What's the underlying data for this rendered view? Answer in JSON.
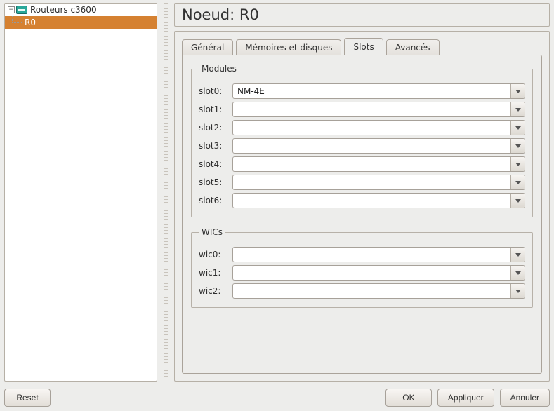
{
  "tree": {
    "root_label": "Routeurs c3600",
    "child_label": "R0"
  },
  "header": {
    "title": "Noeud: R0"
  },
  "tabs": {
    "general": "Général",
    "memdisk": "Mémoires et disques",
    "slots": "Slots",
    "advanced": "Avancés"
  },
  "modules": {
    "legend": "Modules",
    "rows": [
      {
        "label": "slot0:",
        "value": "NM-4E"
      },
      {
        "label": "slot1:",
        "value": ""
      },
      {
        "label": "slot2:",
        "value": ""
      },
      {
        "label": "slot3:",
        "value": ""
      },
      {
        "label": "slot4:",
        "value": ""
      },
      {
        "label": "slot5:",
        "value": ""
      },
      {
        "label": "slot6:",
        "value": ""
      }
    ]
  },
  "wics": {
    "legend": "WICs",
    "rows": [
      {
        "label": "wic0:",
        "value": ""
      },
      {
        "label": "wic1:",
        "value": ""
      },
      {
        "label": "wic2:",
        "value": ""
      }
    ]
  },
  "buttons": {
    "reset": "Reset",
    "ok": "OK",
    "apply": "Appliquer",
    "cancel": "Annuler"
  }
}
